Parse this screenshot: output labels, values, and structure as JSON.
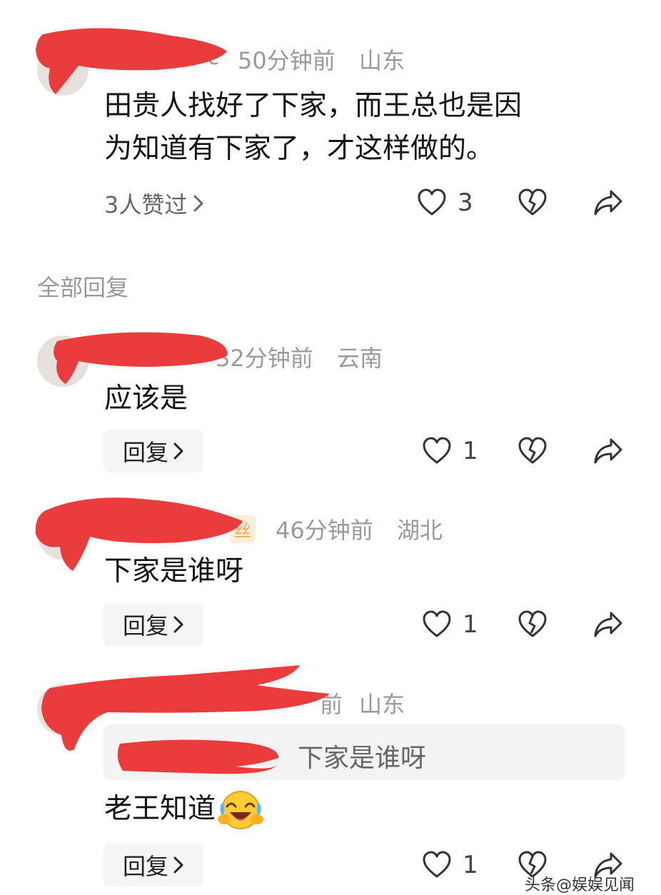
{
  "comments": [
    {
      "time": "50分钟前",
      "location": "山东",
      "name_fragment": "c",
      "text_line1": "田贵人找好了下家，而王总也是因",
      "text_line2": "为知道有下家了，才这样做的。",
      "liked_by": "3人赞过",
      "likes": "3"
    },
    {
      "time": "32分钟前",
      "location": "云南",
      "text": "应该是",
      "reply_label": "回复",
      "likes": "1"
    },
    {
      "time": "46分钟前",
      "location": "湖北",
      "badge": "丝",
      "text": "下家是谁呀",
      "reply_label": "回复",
      "likes": "1"
    },
    {
      "time_fragment": "前",
      "location": "山东",
      "quote_text": "下家是谁呀",
      "text": "老王知道",
      "reply_label": "回复",
      "likes": "1"
    }
  ],
  "section_title": "全部回复",
  "watermark": "头条@娱娱见闻",
  "icons": [
    "heart-icon",
    "broken-heart-icon",
    "share-icon",
    "chevron-right-icon",
    "laughing-emoji-icon"
  ],
  "colors": {
    "redaction": "#ea3c3c",
    "meta_text": "#9a9a9a",
    "reply_bg": "#f5f5f5"
  }
}
